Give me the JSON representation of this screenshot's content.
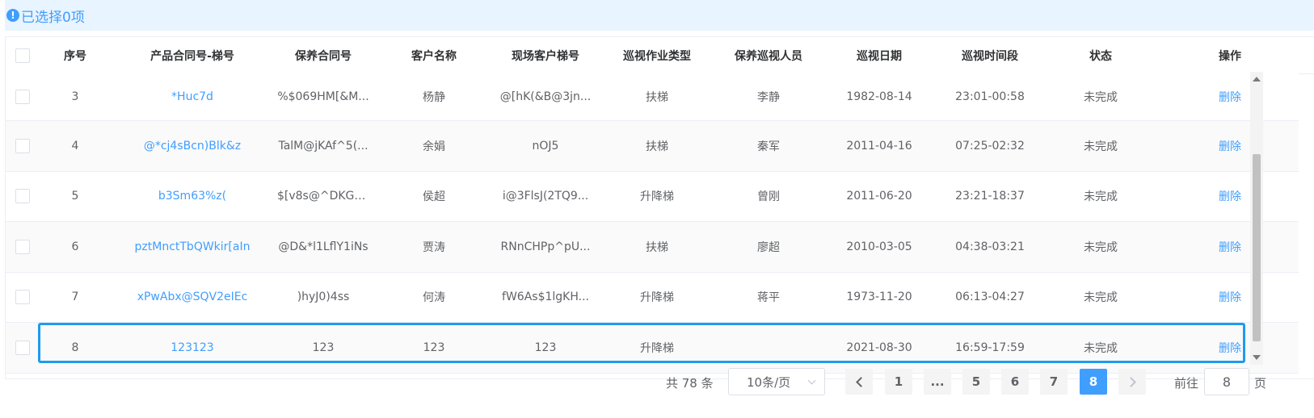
{
  "alert": {
    "text": "已选择0项"
  },
  "table": {
    "headers": [
      "序号",
      "产品合同号-梯号",
      "保养合同号",
      "客户名称",
      "现场客户梯号",
      "巡视作业类型",
      "保养巡视人员",
      "巡视日期",
      "巡视时间段",
      "状态",
      "操作"
    ],
    "rows": [
      {
        "index": "3",
        "product_contract": "*Huc7d",
        "maint_contract": "%$069HM[&M...",
        "customer": "杨静",
        "site_elevator": "@[hK(&B@3jn...",
        "inspection_type": "扶梯",
        "inspector": "李静",
        "date": "1982-08-14",
        "time_range": "23:01-00:58",
        "status": "未完成",
        "action": "删除"
      },
      {
        "index": "4",
        "product_contract": "@*cj4sBcn)Blk&z",
        "maint_contract": "TalM@jKAf^5(...",
        "customer": "余娟",
        "site_elevator": "nOJ5",
        "inspection_type": "扶梯",
        "inspector": "秦军",
        "date": "2011-04-16",
        "time_range": "07:25-02:32",
        "status": "未完成",
        "action": "删除"
      },
      {
        "index": "5",
        "product_contract": "b3Sm63%z(",
        "maint_contract": "$[v8s@^DKGZ...",
        "customer": "侯超",
        "site_elevator": "i@3FlsJ(2TQ9...",
        "inspection_type": "升降梯",
        "inspector": "曾刚",
        "date": "2011-06-20",
        "time_range": "23:21-18:37",
        "status": "未完成",
        "action": "删除"
      },
      {
        "index": "6",
        "product_contract": "pztMnctTbQWkir[aIn",
        "maint_contract": "@D&*l1LflY1iNs",
        "customer": "贾涛",
        "site_elevator": "RNnCHPp^pU...",
        "inspection_type": "扶梯",
        "inspector": "廖超",
        "date": "2010-03-05",
        "time_range": "04:38-03:21",
        "status": "未完成",
        "action": "删除"
      },
      {
        "index": "7",
        "product_contract": "xPwAbx@SQV2eIEc",
        "maint_contract": ")hyJ0)4ss",
        "customer": "何涛",
        "site_elevator": "fW6As$1lgKH...",
        "inspection_type": "升降梯",
        "inspector": "蒋平",
        "date": "1973-11-20",
        "time_range": "06:13-04:27",
        "status": "未完成",
        "action": "删除"
      },
      {
        "index": "8",
        "product_contract": "123123",
        "maint_contract": "123",
        "customer": "123",
        "site_elevator": "123",
        "inspection_type": "升降梯",
        "inspector": "",
        "date": "2021-08-30",
        "time_range": "16:59-17:59",
        "status": "未完成",
        "action": "删除"
      }
    ]
  },
  "pagination": {
    "total_text": "共 78 条",
    "page_size": "10条/页",
    "pages": [
      "1",
      "...",
      "5",
      "6",
      "7",
      "8"
    ],
    "current_page": "8",
    "goto_label": "前往",
    "goto_value": "8",
    "goto_suffix": "页"
  },
  "colors": {
    "accent": "#409eff",
    "highlight": "#1e9bf0",
    "alert_bg": "#e8f4ff"
  }
}
